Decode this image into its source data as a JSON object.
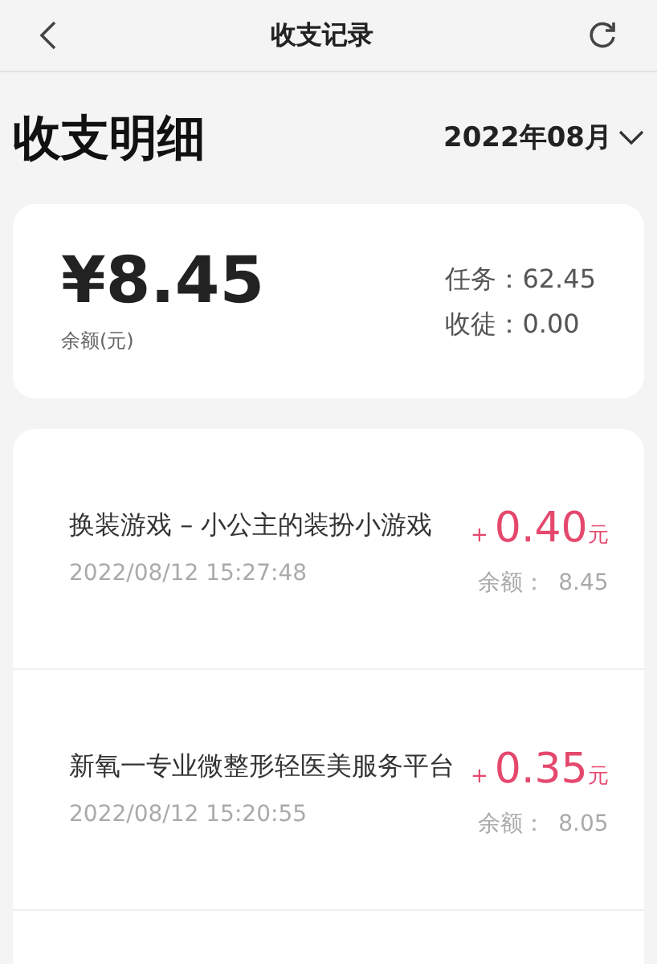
{
  "header": {
    "title": "收支记录"
  },
  "summary": {
    "title": "收支明细",
    "month": "2022年08月",
    "balance": "¥8.45",
    "balance_label": "余额(元)",
    "stats": [
      {
        "label": "任务：",
        "value": "62.45"
      },
      {
        "label": "收徒：",
        "value": "0.00"
      }
    ]
  },
  "records": [
    {
      "title": "换装游戏 – 小公主的装扮小游戏",
      "time": "2022/08/12 15:27:48",
      "sign": "+",
      "amount": "0.40",
      "unit": "元",
      "balance_label": "余额：",
      "balance": "8.45"
    },
    {
      "title": "新氧一专业微整形轻医美服务平台",
      "time": "2022/08/12 15:20:55",
      "sign": "+",
      "amount": "0.35",
      "unit": "元",
      "balance_label": "余额：",
      "balance": "8.05"
    }
  ]
}
